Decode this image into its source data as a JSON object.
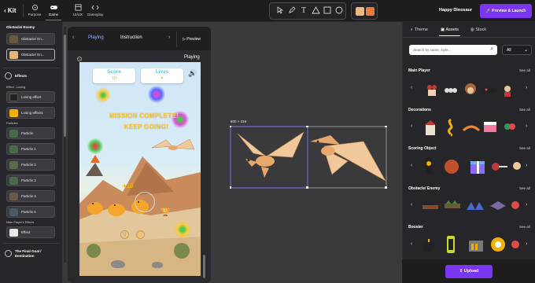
{
  "topbar": {
    "back_label": "Kit",
    "tabs": [
      {
        "label": "Purpose"
      },
      {
        "label": "Game"
      },
      {
        "label": "UI/UX"
      },
      {
        "label": "Gameplay"
      }
    ],
    "project_name": "Happy Dinosaur",
    "launch_label": "Preview & Launch",
    "colors": {
      "swatch_1": "#f0b783",
      "swatch_2": "#f07a3c",
      "accent": "#7a36f0"
    }
  },
  "left_panel": {
    "obstacles_heading": "Obstacle/ Enemy",
    "obstacle_items": [
      "Obstacle/ En...",
      "Obstacle/ En..."
    ],
    "effects_heading": "Effects",
    "effect_losing_sub": "Effect - Losing",
    "losing_items": [
      "Losing effect",
      "Losing effect1"
    ],
    "particles_sub": "Particles",
    "particle_items": [
      "Particle",
      "Particle 1",
      "Particle 2",
      "Particle 3",
      "Particle 4",
      "Particle 5"
    ],
    "main_player_sub": "Main Player's Effects",
    "main_player_items": [
      "Effect"
    ],
    "final_goal_heading": "The Final Goal / Destination"
  },
  "preview_panel": {
    "tabs": [
      "Playing",
      "Instruction"
    ],
    "preview_label": "Preview",
    "state_label": "Playing",
    "help": "?"
  },
  "game": {
    "score_label": "Score",
    "score_value": "10",
    "lives_label": "Lives",
    "mission_line1": "MISSION COMPLETE!",
    "mission_line2": "KEEP GOING!",
    "plus_points": "+10"
  },
  "canvas": {
    "selection_size": "600 × 316"
  },
  "right_panel": {
    "tabs": [
      "Theme",
      "Assets",
      "Stock"
    ],
    "active_tab": "Assets",
    "search_placeholder": "Search by name, style,...",
    "filter_value": "All",
    "see_all": "See all",
    "categories": [
      "Main Player",
      "Decorations",
      "Scoring Object",
      "Obstacle/ Enemy",
      "Booster"
    ],
    "upload_label": "Upload"
  }
}
